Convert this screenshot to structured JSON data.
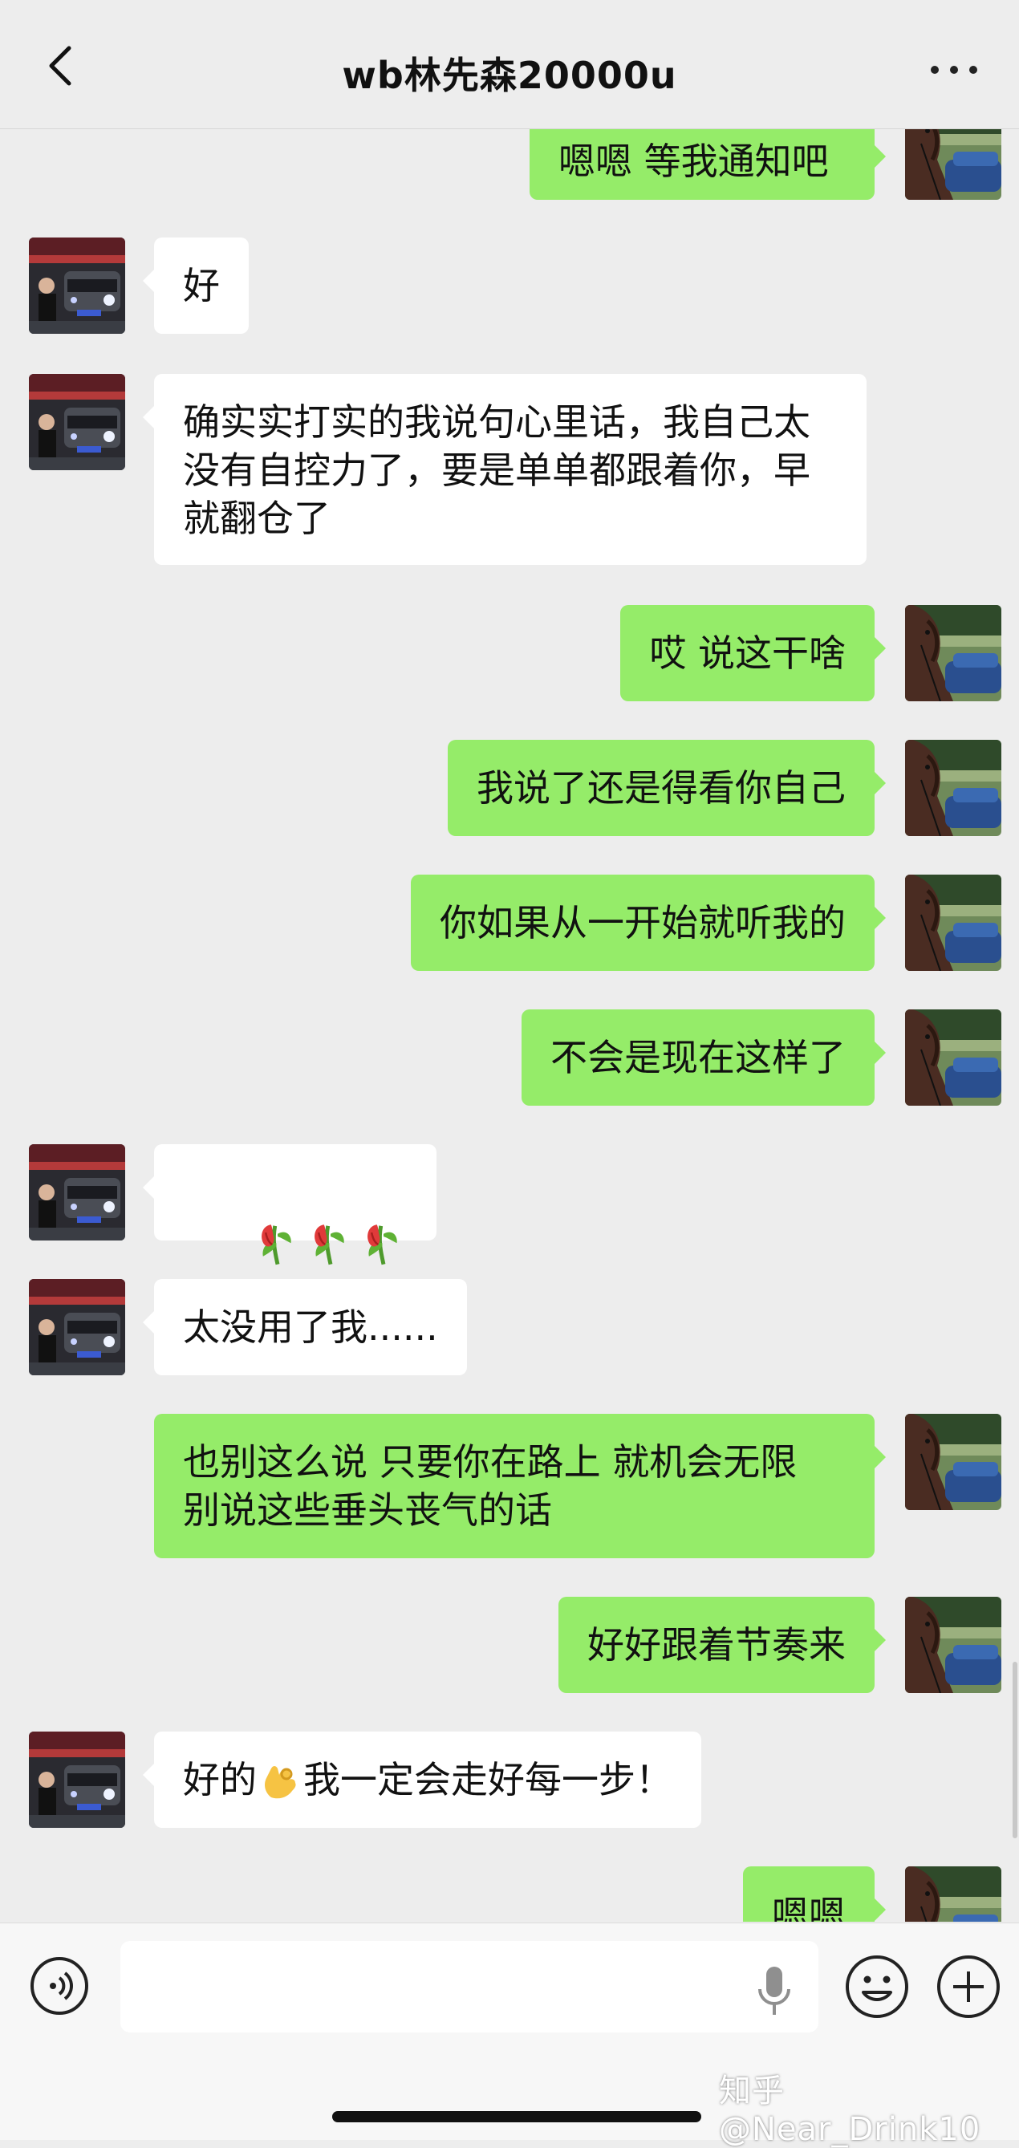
{
  "header": {
    "title": "wb林先森20000u"
  },
  "colors": {
    "incoming_bubble": "#ffffff",
    "outgoing_bubble": "#95ec69",
    "background": "#ededed"
  },
  "messages": [
    {
      "side": "out",
      "text": "嗯嗯 等我通知吧"
    },
    {
      "side": "in",
      "text": "好"
    },
    {
      "side": "in",
      "text": "确实实打实的我说句心里话，我自己太没有自控力了，要是单单都跟着你，早就翻仓了"
    },
    {
      "side": "out",
      "text": "哎 说这干啥"
    },
    {
      "side": "out",
      "text": "我说了还是得看你自己"
    },
    {
      "side": "out",
      "text": "你如果从一开始就听我的"
    },
    {
      "side": "out",
      "text": "不会是现在这样了"
    },
    {
      "side": "in",
      "text": "",
      "emoji": "wilted-rose x3"
    },
    {
      "side": "in",
      "text": "太没用了我......"
    },
    {
      "side": "out",
      "text": "也别这么说 只要你在路上 就机会无限\n别说这些垂头丧气的话"
    },
    {
      "side": "out",
      "text": "好好跟着节奏来"
    },
    {
      "side": "in",
      "text_before": "好的",
      "emoji": "ok-hand",
      "text_after": "我一定会走好每一步！"
    },
    {
      "side": "out",
      "text": "嗯嗯"
    }
  ],
  "input": {
    "value": "",
    "placeholder": ""
  },
  "icons": {
    "back": "chevron-left-icon",
    "more": "more-dots-icon",
    "voice": "voice-icon",
    "mic": "microphone-icon",
    "emoji": "emoji-icon",
    "plus": "plus-icon"
  },
  "watermark": "知乎 @Near_Drink10"
}
